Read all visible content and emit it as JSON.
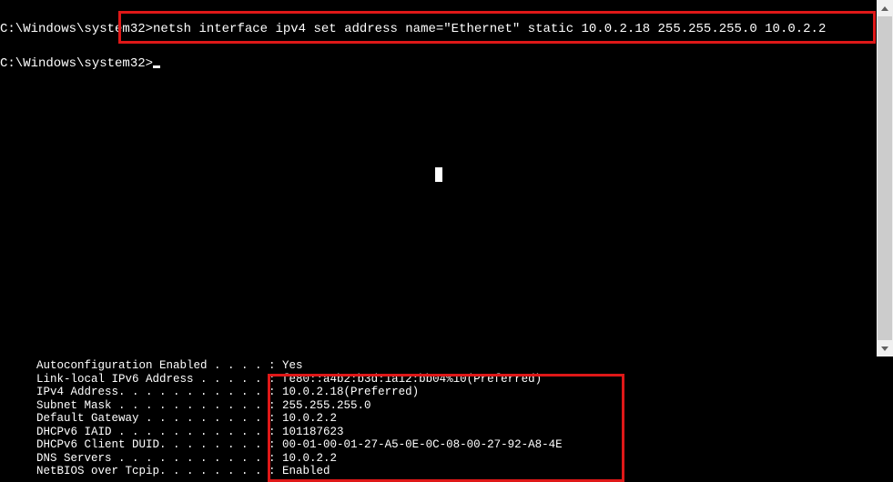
{
  "top_terminal": {
    "prompt1": "C:\\Windows\\system32>",
    "command1": "netsh interface ipv4 set address name=\"Ethernet\" static 10.0.2.18 255.255.255.0 10.0.2.2",
    "prompt2": "C:\\Windows\\system32>"
  },
  "ipconfig": {
    "rows": [
      {
        "label": "Autoconfiguration Enabled . . . . : ",
        "value": "Yes"
      },
      {
        "label": "Link-local IPv6 Address . . . . . : ",
        "value": "fe80::a4b2:b3d:1a12:bb04%10(Preferred)"
      },
      {
        "label": "IPv4 Address. . . . . . . . . . . : ",
        "value": "10.0.2.18(Preferred)"
      },
      {
        "label": "Subnet Mask . . . . . . . . . . . : ",
        "value": "255.255.255.0"
      },
      {
        "label": "Default Gateway . . . . . . . . . : ",
        "value": "10.0.2.2"
      },
      {
        "label": "DHCPv6 IAID . . . . . . . . . . . : ",
        "value": "101187623"
      },
      {
        "label": "DHCPv6 Client DUID. . . . . . . . : ",
        "value": "00-01-00-01-27-A5-0E-0C-08-00-27-92-A8-4E"
      },
      {
        "label": "DNS Servers . . . . . . . . . . . : ",
        "value": "10.0.2.2"
      },
      {
        "label": "NetBIOS over Tcpip. . . . . . . . : ",
        "value": "Enabled"
      }
    ]
  },
  "highlight_color": "#df1818"
}
